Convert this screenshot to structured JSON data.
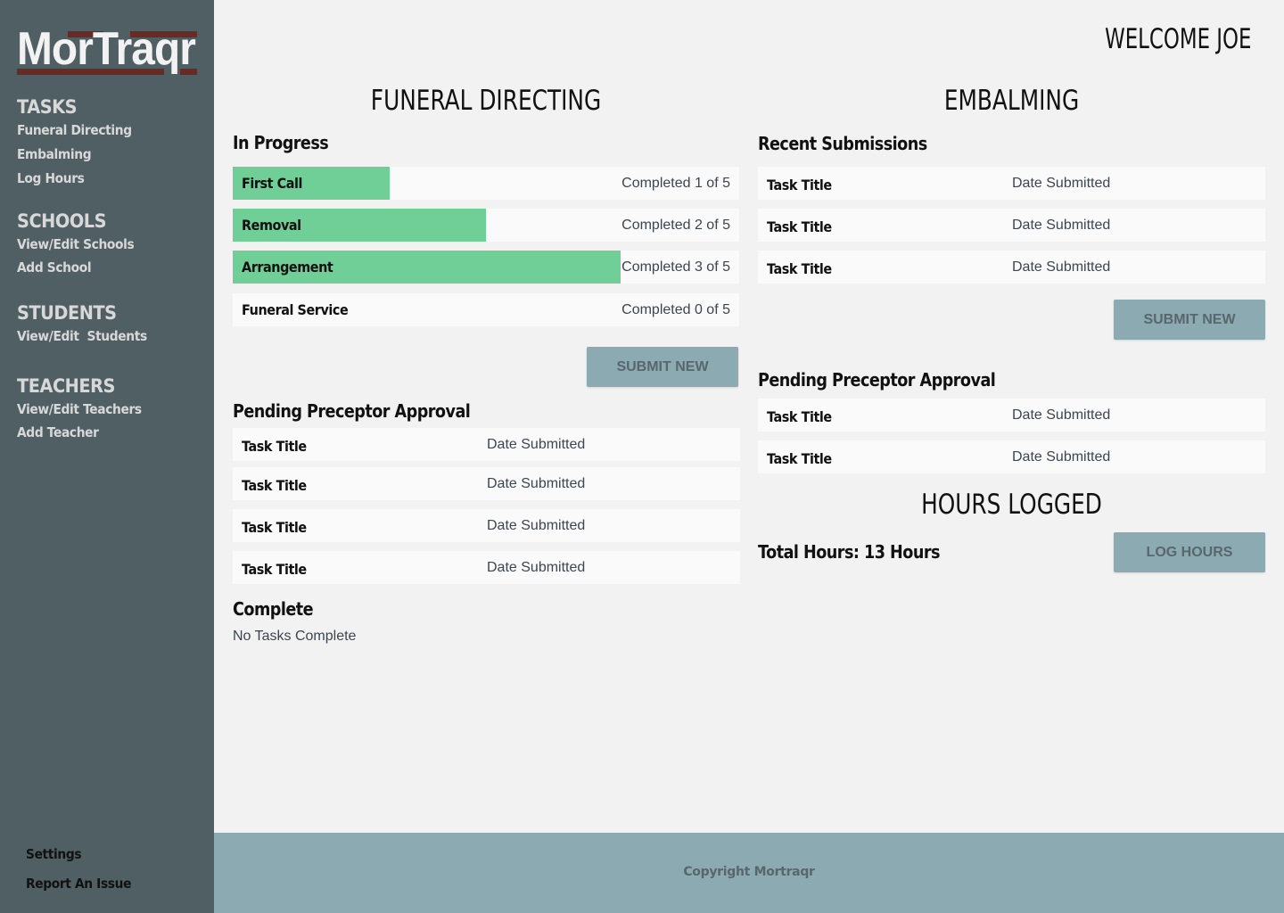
{
  "app": {
    "logo_text": "MorTraqr"
  },
  "sidebar": {
    "sections": [
      {
        "heading": "TASKS",
        "items": [
          "Funeral Directing",
          "Embalming",
          "Log Hours"
        ]
      },
      {
        "heading": "SCHOOLS",
        "items": [
          "View/Edit Schools",
          "Add School"
        ]
      },
      {
        "heading": "STUDENTS",
        "items": [
          "View/Edit  Students"
        ]
      },
      {
        "heading": "TEACHERS",
        "items": [
          "View/Edit Teachers",
          "Add Teacher"
        ]
      }
    ],
    "bottom_items": [
      "Settings",
      "Report An Issue"
    ]
  },
  "header": {
    "welcome": "WELCOME JOE"
  },
  "funeral_directing": {
    "title": "FUNERAL DIRECTING",
    "in_progress": {
      "heading": "In Progress",
      "tasks": [
        {
          "name": "First Call",
          "status": "Completed 1 of 5",
          "completed": 1,
          "total": 5
        },
        {
          "name": "Removal",
          "status": "Completed 2 of 5",
          "completed": 2,
          "total": 5
        },
        {
          "name": "Arrangement",
          "status": "Completed 3 of 5",
          "completed": 3,
          "total": 5
        },
        {
          "name": "Funeral Service",
          "status": "Completed 0 of 5",
          "completed": 0,
          "total": 5
        }
      ]
    },
    "submit_label": "SUBMIT NEW",
    "pending": {
      "heading": "Pending Preceptor Approval",
      "rows": [
        {
          "title": "Task Title",
          "date": "Date Submitted"
        },
        {
          "title": "Task Title",
          "date": "Date Submitted"
        },
        {
          "title": "Task Title",
          "date": "Date Submitted"
        },
        {
          "title": "Task Title",
          "date": "Date Submitted"
        }
      ]
    },
    "complete": {
      "heading": "Complete",
      "empty_text": "No Tasks Complete"
    }
  },
  "embalming": {
    "title": "EMBALMING",
    "recent": {
      "heading": "Recent Submissions",
      "rows": [
        {
          "title": "Task Title",
          "date": "Date Submitted"
        },
        {
          "title": "Task Title",
          "date": "Date Submitted"
        },
        {
          "title": "Task Title",
          "date": "Date Submitted"
        }
      ]
    },
    "submit_label": "SUBMIT NEW",
    "pending": {
      "heading": "Pending Preceptor Approval",
      "rows": [
        {
          "title": "Task Title",
          "date": "Date Submitted"
        },
        {
          "title": "Task Title",
          "date": "Date Submitted"
        }
      ]
    }
  },
  "hours": {
    "title": "HOURS LOGGED",
    "total_text": "Total Hours: 13 Hours",
    "log_label": "LOG HOURS"
  },
  "footer": {
    "copyright": "Copyright Mortraqr"
  },
  "colors": {
    "sidebar": "#505f64",
    "progress": "#70cf97",
    "button": "#8caab2",
    "logo_bar": "#6a2a24"
  }
}
